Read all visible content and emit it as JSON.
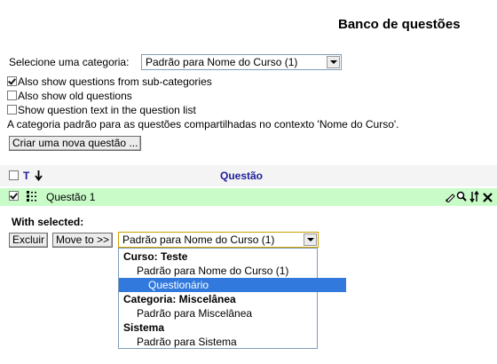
{
  "page": {
    "title": "Banco de questões"
  },
  "category": {
    "label": "Selecione uma categoria:",
    "selected": "Padrão para Nome do Curso (1)"
  },
  "options": {
    "subcategories": "Also show questions from sub-categories",
    "old": "Also show old questions",
    "show_text": "Show question text in the question list"
  },
  "info": "A categoria padrão para as questões compartilhadas no contexto 'Nome do Curso'.",
  "create_button": "Criar uma nova questão ...",
  "table": {
    "col_type": "T",
    "col_question": "Questão",
    "rows": [
      {
        "name": "Questão 1"
      }
    ]
  },
  "with_selected": {
    "label": "With selected:",
    "delete": "Excluir",
    "move": "Move to >>",
    "target": "Padrão para Nome do Curso (1)"
  },
  "dropdown": {
    "items": [
      {
        "text": "Curso: Teste",
        "kind": "group"
      },
      {
        "text": "Padrão para Nome do Curso (1)",
        "kind": "item"
      },
      {
        "text": "Questionário",
        "kind": "sub",
        "selected": true
      },
      {
        "text": "Categoria: Miscelânea",
        "kind": "group"
      },
      {
        "text": "Padrão para Miscelânea",
        "kind": "item"
      },
      {
        "text": "Sistema",
        "kind": "group"
      },
      {
        "text": "Padrão para Sistema",
        "kind": "item"
      }
    ]
  },
  "colors": {
    "row_highlight": "#c8fbc8",
    "header_text": "#20209a",
    "selection": "#3179dd"
  }
}
